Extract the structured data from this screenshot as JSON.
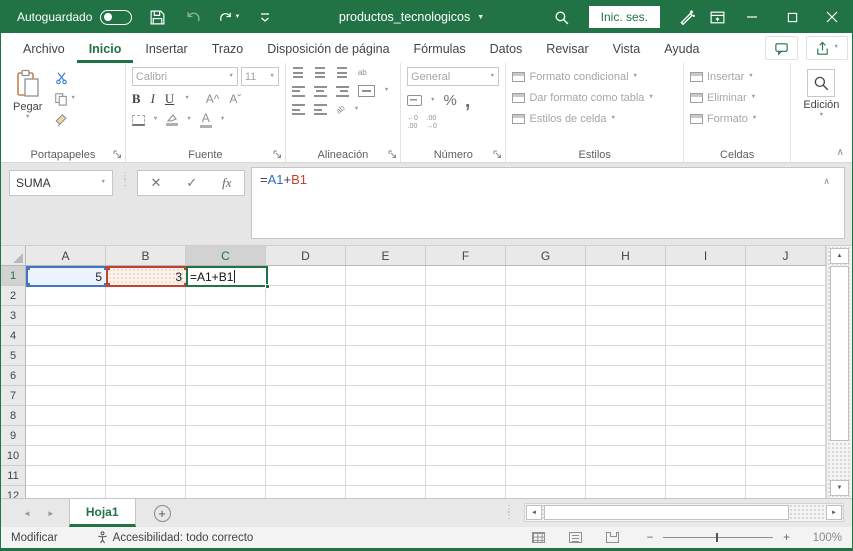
{
  "colors": {
    "accent_green": "#217346",
    "ref_blue": "#2a6cc9",
    "ref_red": "#c0432b"
  },
  "icons": {
    "caret_down": "▼",
    "caret_up": "▲",
    "chevron_left": "◄",
    "chevron_right": "►",
    "dots_vertical": "⋮\n⋮",
    "collapse_up": "∧",
    "cancel": "✕",
    "check": "✓",
    "fx": "fx",
    "add_sheet": "+",
    "percent": "%",
    "comma": ","
  },
  "titlebar": {
    "autosave_label": "Autoguardado",
    "autosave_state": "off",
    "document_title": "productos_tecnologicos",
    "signin_label": "Inic. ses."
  },
  "ribbon_tabs": [
    {
      "label": "Archivo",
      "active": false
    },
    {
      "label": "Inicio",
      "active": true
    },
    {
      "label": "Insertar",
      "active": false
    },
    {
      "label": "Trazo",
      "active": false
    },
    {
      "label": "Disposición de página",
      "active": false
    },
    {
      "label": "Fórmulas",
      "active": false
    },
    {
      "label": "Datos",
      "active": false
    },
    {
      "label": "Revisar",
      "active": false
    },
    {
      "label": "Vista",
      "active": false
    },
    {
      "label": "Ayuda",
      "active": false
    }
  ],
  "ribbon": {
    "clipboard": {
      "group_label": "Portapapeles",
      "paste_label": "Pegar"
    },
    "font": {
      "group_label": "Fuente",
      "font_name": "Calibri",
      "font_size": "11",
      "bold": "B",
      "italic": "I",
      "underline": "U",
      "grow": "A^",
      "shrink": "Aˇ",
      "font_color_letter": "A"
    },
    "alignment": {
      "group_label": "Alineación",
      "wrap_label": "ab",
      "orient_label": "ab"
    },
    "number": {
      "group_label": "Número",
      "format": "General",
      "increase_decimal": "←0\n.00",
      "decrease_decimal": ".00\n→0"
    },
    "styles": {
      "group_label": "Estilos",
      "items": [
        {
          "label": "Formato condicional"
        },
        {
          "label": "Dar formato como tabla"
        },
        {
          "label": "Estilos de celda"
        }
      ]
    },
    "cells": {
      "group_label": "Celdas",
      "items": [
        {
          "label": "Insertar"
        },
        {
          "label": "Eliminar"
        },
        {
          "label": "Formato"
        }
      ]
    },
    "editing": {
      "label": "Edición"
    }
  },
  "formula_bar": {
    "name_box": "SUMA",
    "formula": {
      "full": "=A1+B1",
      "parts": [
        {
          "text": "="
        },
        {
          "text": "A1"
        },
        {
          "text": "+"
        },
        {
          "text": "B1"
        }
      ]
    }
  },
  "grid": {
    "columns": [
      "A",
      "B",
      "C",
      "D",
      "E",
      "F",
      "G",
      "H",
      "I",
      "J"
    ],
    "selected_column": "C",
    "rows": [
      "1",
      "2",
      "3",
      "4",
      "5",
      "6",
      "7",
      "8",
      "9",
      "10",
      "11",
      "12"
    ],
    "selected_row": "1",
    "cells": [
      {
        "ref": "A1",
        "value": "5"
      },
      {
        "ref": "B1",
        "value": "3"
      },
      {
        "ref": "C1",
        "value": "=A1+B1"
      }
    ]
  },
  "sheet_tabs": {
    "active": "Hoja1"
  },
  "status_bar": {
    "mode": "Modificar",
    "accessibility": "Accesibilidad: todo correcto",
    "zoom": "100%"
  }
}
